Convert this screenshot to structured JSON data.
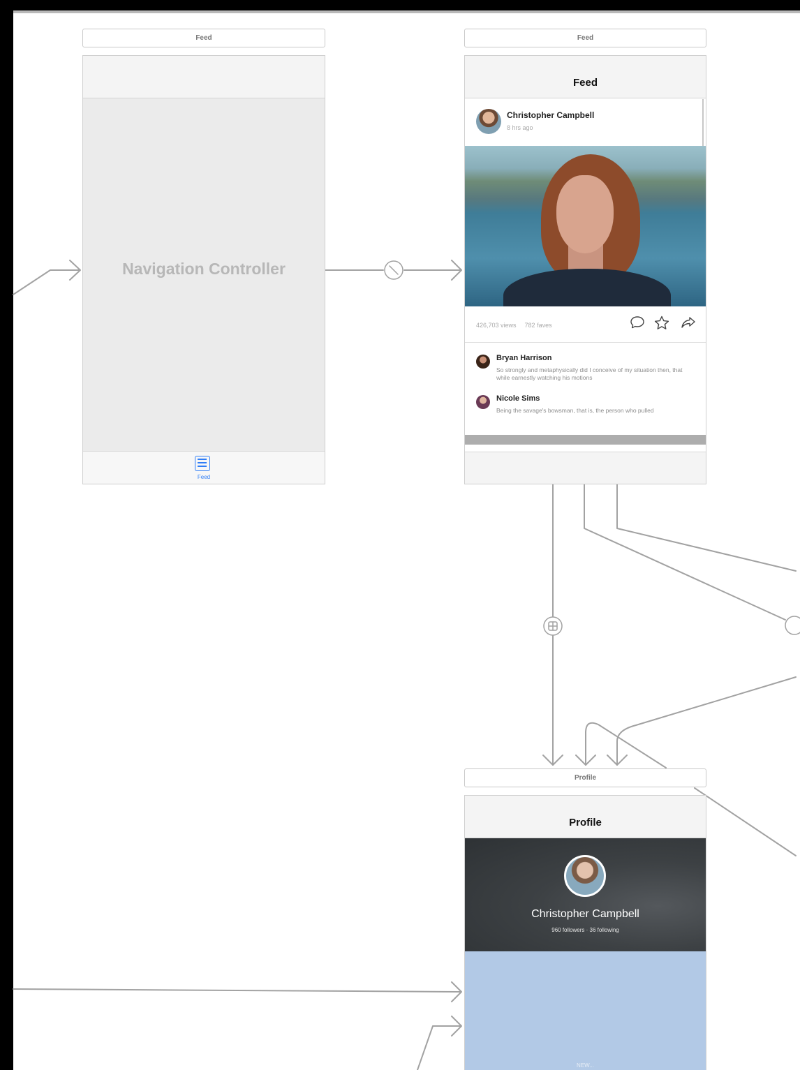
{
  "nav_controller": {
    "scene_title": "Feed",
    "label": "Navigation Controller",
    "tab_label": "Feed"
  },
  "feed": {
    "scene_title": "Feed",
    "nav_title": "Feed",
    "post": {
      "author": "Christopher Campbell",
      "time": "8 hrs ago",
      "views": "426,703 views",
      "faves": "782 faves"
    },
    "comments": [
      {
        "name": "Bryan Harrison",
        "text": "So strongly and metaphysically did I conceive of my situation then, that while earnestly watching his motions"
      },
      {
        "name": "Nicole Sims",
        "text": "Being the savage's bowsman, that is, the person who pulled"
      }
    ]
  },
  "profile": {
    "scene_title": "Profile",
    "nav_title": "Profile",
    "name": "Christopher Campbell",
    "stats": "960 followers · 36 following",
    "bottom_label": "NEW..."
  },
  "colors": {
    "canvas": "#ffffff",
    "scene_border": "#cfcfcf",
    "connector": "#9e9e9e",
    "tint": "#2f7df6",
    "profile_body": "#b2c9e6"
  }
}
